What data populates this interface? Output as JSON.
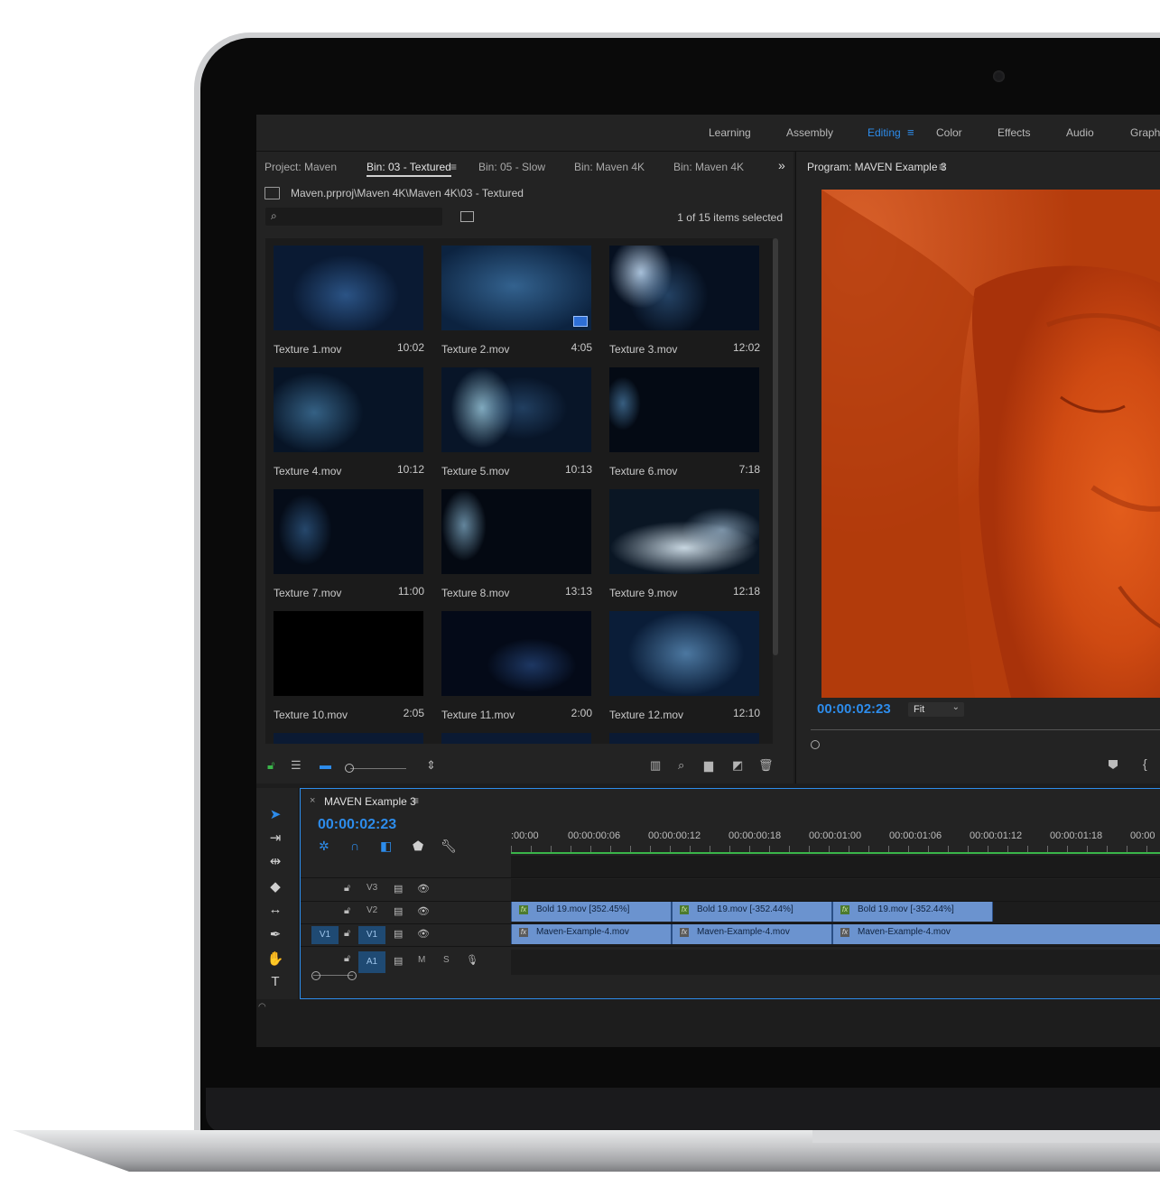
{
  "workspaces": {
    "items": [
      {
        "label": "Learning",
        "active": false
      },
      {
        "label": "Assembly",
        "active": false
      },
      {
        "label": "Editing",
        "active": true
      },
      {
        "label": "Color",
        "active": false
      },
      {
        "label": "Effects",
        "active": false
      },
      {
        "label": "Audio",
        "active": false
      },
      {
        "label": "Graphi",
        "active": false
      }
    ],
    "menu_glyph": "≡"
  },
  "project": {
    "tabs": [
      {
        "label": "Project: Maven",
        "active": false
      },
      {
        "label": "Bin: 03 - Textured",
        "active": true
      },
      {
        "label": "Bin: 05 - Slow",
        "active": false
      },
      {
        "label": "Bin: Maven 4K",
        "active": false
      },
      {
        "label": "Bin: Maven 4K",
        "active": false
      }
    ],
    "overflow_glyph": "»",
    "path": "Maven.prproj\\Maven 4K\\Maven 4K\\03 - Textured",
    "search_placeholder": "",
    "selection_status": "1 of 15 items selected",
    "clips": [
      {
        "name": "Texture 1.mov",
        "duration": "10:02"
      },
      {
        "name": "Texture 2.mov",
        "duration": "4:05"
      },
      {
        "name": "Texture 3.mov",
        "duration": "12:02"
      },
      {
        "name": "Texture 4.mov",
        "duration": "10:12"
      },
      {
        "name": "Texture 5.mov",
        "duration": "10:13"
      },
      {
        "name": "Texture 6.mov",
        "duration": "7:18"
      },
      {
        "name": "Texture 7.mov",
        "duration": "11:00"
      },
      {
        "name": "Texture 8.mov",
        "duration": "13:13"
      },
      {
        "name": "Texture 9.mov",
        "duration": "12:18"
      },
      {
        "name": "Texture 10.mov",
        "duration": "2:05"
      },
      {
        "name": "Texture 11.mov",
        "duration": "2:00"
      },
      {
        "name": "Texture 12.mov",
        "duration": "12:10"
      }
    ],
    "toolbar_icons": [
      "lock-icon",
      "list-view-icon",
      "icon-view-icon",
      "zoom-slider",
      "sort-icon",
      "automate-to-sequence-icon",
      "find-icon",
      "new-bin-icon",
      "new-item-icon",
      "trash-icon"
    ]
  },
  "program": {
    "title": "Program: MAVEN Example 3",
    "timecode": "00:00:02:23",
    "zoom": "Fit"
  },
  "timeline": {
    "sequence": "MAVEN Example 3",
    "timecode": "00:00:02:23",
    "ruler": [
      ":00:00",
      "00:00:00:06",
      "00:00:00:12",
      "00:00:00:18",
      "00:00:01:00",
      "00:00:01:06",
      "00:00:01:12",
      "00:00:01:18",
      "00:00"
    ],
    "tracks": [
      {
        "id": "V3",
        "clips": []
      },
      {
        "id": "V2",
        "clips": [
          {
            "name": "Bold 19.mov [352.45%]"
          },
          {
            "name": "Bold 19.mov [-352.44%]"
          },
          {
            "name": "Bold 19.mov [-352.44%]"
          }
        ]
      },
      {
        "id": "V1",
        "source_patch": "V1",
        "clips": [
          {
            "name": "Maven-Example-4.mov"
          },
          {
            "name": "Maven-Example-4.mov"
          },
          {
            "name": "Maven-Example-4.mov"
          }
        ]
      },
      {
        "id": "A1",
        "mute": "M",
        "solo": "S",
        "clips": []
      }
    ]
  },
  "colors": {
    "accent": "#2d8ceb",
    "panel": "#232323",
    "clip": "#6b93cf",
    "video_orange": "#c2410f"
  }
}
